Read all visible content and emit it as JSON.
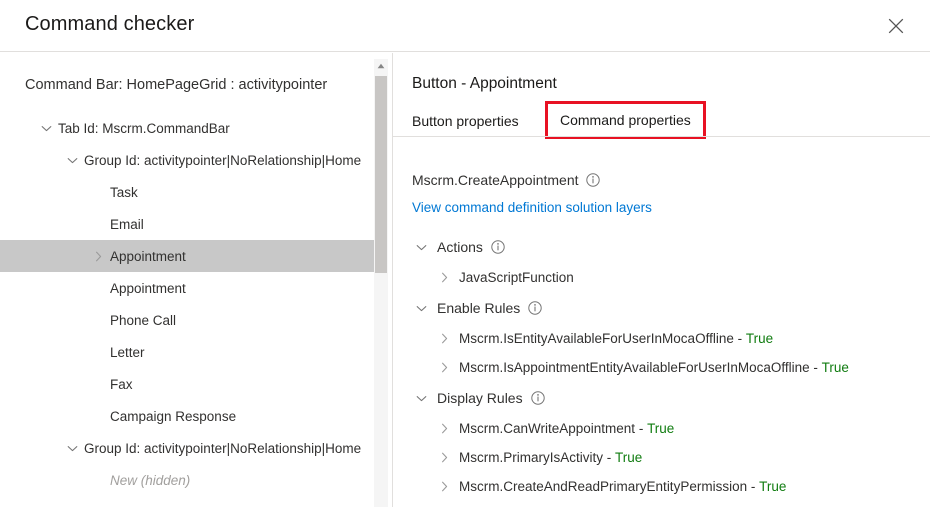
{
  "dialog": {
    "title": "Command checker",
    "close_label": "Close",
    "close_icon": "close-icon"
  },
  "left_panel": {
    "command_bar_title": "Command Bar: HomePageGrid : activitypointer",
    "tree": [
      {
        "label": "Tab Id: Mscrm.CommandBar",
        "indent": 0,
        "chevron": "chevron-down-icon",
        "selected": false,
        "hidden": false
      },
      {
        "label": "Group Id: activitypointer|NoRelationship|Home",
        "indent": 1,
        "chevron": "chevron-down-icon",
        "selected": false,
        "hidden": false
      },
      {
        "label": "Task",
        "indent": 2,
        "chevron": "none",
        "selected": false,
        "hidden": false
      },
      {
        "label": "Email",
        "indent": 2,
        "chevron": "none",
        "selected": false,
        "hidden": false
      },
      {
        "label": "Appointment",
        "indent": 2,
        "chevron": "chevron-right-icon",
        "selected": true,
        "hidden": false
      },
      {
        "label": "Appointment",
        "indent": 2,
        "chevron": "none",
        "selected": false,
        "hidden": false
      },
      {
        "label": "Phone Call",
        "indent": 2,
        "chevron": "none",
        "selected": false,
        "hidden": false
      },
      {
        "label": "Letter",
        "indent": 2,
        "chevron": "none",
        "selected": false,
        "hidden": false
      },
      {
        "label": "Fax",
        "indent": 2,
        "chevron": "none",
        "selected": false,
        "hidden": false
      },
      {
        "label": "Campaign Response",
        "indent": 2,
        "chevron": "none",
        "selected": false,
        "hidden": false
      },
      {
        "label": "Group Id: activitypointer|NoRelationship|Home",
        "indent": 1,
        "chevron": "chevron-down-icon",
        "selected": false,
        "hidden": false
      },
      {
        "label": "New (hidden)",
        "indent": 2,
        "chevron": "none",
        "selected": false,
        "hidden": true
      }
    ],
    "scrollbar": {
      "up_arrow_icon": "scroll-up-arrow-icon",
      "thumb_label": "vertical-scroll-thumb"
    }
  },
  "right_panel": {
    "title": "Button - Appointment",
    "tabs": [
      {
        "label": "Button properties",
        "selected": false
      },
      {
        "label": "Command properties",
        "selected": true
      }
    ],
    "highlight_color": "#e81123",
    "command_name": "Mscrm.CreateAppointment",
    "command_info_icon": "info-circle-icon",
    "solution_layers_link": "View command definition solution layers",
    "link_color": "#0078d4",
    "true_color": "#107c10",
    "sections": [
      {
        "title": "Actions",
        "info_icon": "info-circle-icon",
        "chevron": "chevron-down-icon",
        "items": [
          {
            "label": "JavaScriptFunction",
            "result": "",
            "chevron": "chevron-right-icon"
          }
        ]
      },
      {
        "title": "Enable Rules",
        "info_icon": "info-circle-icon",
        "chevron": "chevron-down-icon",
        "items": [
          {
            "label": "Mscrm.IsEntityAvailableForUserInMocaOffline",
            "result": "True",
            "chevron": "chevron-right-icon"
          },
          {
            "label": "Mscrm.IsAppointmentEntityAvailableForUserInMocaOffline",
            "result": "True",
            "chevron": "chevron-right-icon"
          }
        ]
      },
      {
        "title": "Display Rules",
        "info_icon": "info-circle-icon",
        "chevron": "chevron-down-icon",
        "items": [
          {
            "label": "Mscrm.CanWriteAppointment",
            "result": "True",
            "chevron": "chevron-right-icon"
          },
          {
            "label": "Mscrm.PrimaryIsActivity",
            "result": "True",
            "chevron": "chevron-right-icon"
          },
          {
            "label": "Mscrm.CreateAndReadPrimaryEntityPermission",
            "result": "True",
            "chevron": "chevron-right-icon"
          }
        ]
      }
    ]
  }
}
